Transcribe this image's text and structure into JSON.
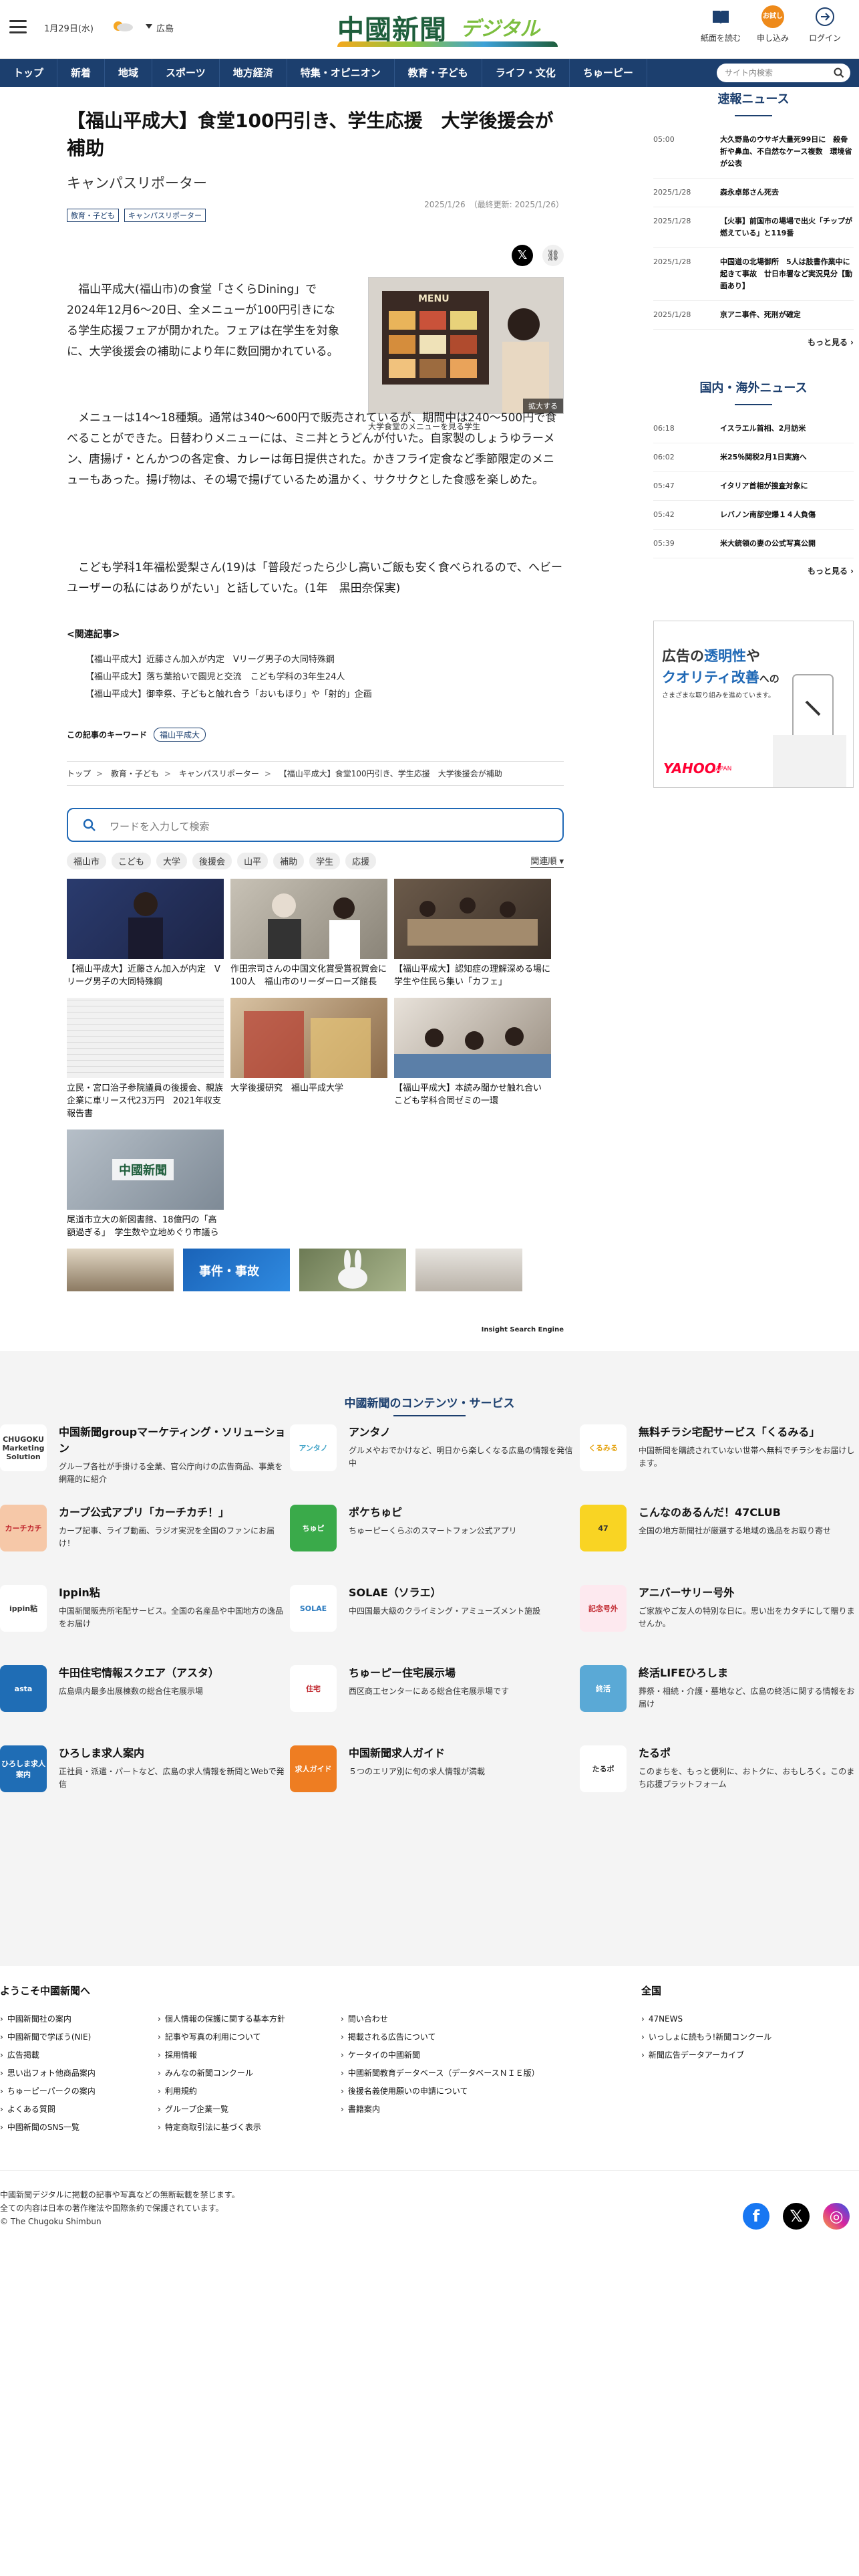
{
  "header": {
    "date": "1月29日(水)",
    "area": "広島",
    "logo_main": "中國新聞",
    "logo_sub": "デジタル",
    "btn_paper": "紙面を読む",
    "btn_apply": "申し込み",
    "btn_apply_badge": "お試し",
    "btn_login": "ログイン"
  },
  "nav": {
    "items": [
      "トップ",
      "新着",
      "地域",
      "スポーツ",
      "地方経済",
      "特集・オピニオン",
      "教育・子ども",
      "ライフ・文化",
      "ちゅーピー"
    ],
    "search_placeholder": "サイト内検索"
  },
  "article": {
    "title": "【福山平成大】食堂100円引き、学生応援　大学後援会が補助",
    "subtitle": "キャンパスリポーター",
    "tags": [
      "教育・子ども",
      "キャンパスリポーター"
    ],
    "date": "2025/1/26",
    "updated": "（最終更新: 2025/1/26）",
    "fig_caption": "大学食堂のメニューを見る学生",
    "fig_expand": "拡大する",
    "fig_menu": "MENU",
    "p1": "　福山平成大(福山市)の食堂「さくらDining」で2024年12月6～20日、全メニューが100円引きになる学生応援フェアが開かれた。フェアは在学生を対象に、大学後援会の補助により年に数回開かれている。",
    "p2": "　メニューは14～18種類。通常は340～600円で販売されているが、期間中は240～500円で食べることができた。日替わりメニューには、ミニ丼とうどんが付いた。自家製のしょうゆラーメン、唐揚げ・とんかつの各定食、カレーは毎日提供された。かきフライ定食など季節限定のメニューもあった。揚げ物は、その場で揚げているため温かく、サクサクとした食感を楽しめた。",
    "p3": "　こども学科1年福松愛梨さん(19)は「普段だったら少し高いご飯も安く食べられるので、へビーユーザーの私にはありがたい」と話していた。(1年　黒田奈保実)",
    "related_head": "<関連記事>",
    "related": [
      "【福山平成大】近藤さん加入が内定　Vリーグ男子の大同特殊鋼",
      "【福山平成大】落ち葉拾いで園児と交流　こども学科の3年生24人",
      "【福山平成大】御幸祭、子どもと触れ合う「おいもほり」や「射的」企画"
    ],
    "keyword_label": "この記事のキーワード",
    "keyword": "福山平成大",
    "breadcrumb": [
      "トップ",
      "教育・子ども",
      "キャンパスリポーター",
      "【福山平成大】食堂100円引き、学生応援　大学後援会が補助"
    ]
  },
  "ise": {
    "placeholder": "ワードを入力して検索",
    "keywords": [
      "福山市",
      "こども",
      "大学",
      "後援会",
      "山平",
      "補助",
      "学生",
      "応援"
    ],
    "sort": "関連順",
    "cards": [
      "【福山平成大】近藤さん加入が内定　Vリーグ男子の大同特殊鋼",
      "作田宗司さんの中国文化賞受賞祝賀会に100人　福山市のリーダーローズ館長",
      "【福山平成大】認知症の理解深める場に　学生や住民ら集い「カフェ」",
      "立民・宮口治子参院議員の後援会、親族企業に車リース代23万円　2021年収支報告書",
      "大学後援研究　福山平成大学",
      "【福山平成大】本読み聞かせ触れ合い　こども学科合同ゼミの一環",
      "尾道市立大の新図書館、18億円の「高額過ぎる」　学生数や立地めぐり市議ら"
    ],
    "card7_logo": "中國新聞",
    "strip_label": "事件・事故",
    "engine": "Insight Search Engine"
  },
  "side": {
    "head1": "速報ニュース",
    "news1": [
      {
        "t": "05:00",
        "x": "大久野島のウサギ大量死99日に　殺骨折や鼻血、不自然なケース複数　環境省が公表"
      },
      {
        "t": "2025/1/28",
        "x": "森永卓郎さん死去"
      },
      {
        "t": "2025/1/28",
        "x": "【火事】前国市の場場で出火「チップが燃えている」と119番"
      },
      {
        "t": "2025/1/28",
        "x": "中国道の北場御所　5人は肢書作業中に起きて事故　廿日市署など実況見分【動画あり】"
      },
      {
        "t": "2025/1/28",
        "x": "京アニ事件、死刑が確定"
      }
    ],
    "more": "もっと見る",
    "head2": "国内・海外ニュース",
    "news2": [
      {
        "t": "06:18",
        "x": "イスラエル首相、2月訪米"
      },
      {
        "t": "06:02",
        "x": "米25％関税2月1日実施へ"
      },
      {
        "t": "05:47",
        "x": "イタリア首相が捜査対象に"
      },
      {
        "t": "05:42",
        "x": "レバノン南部空爆１４人負傷"
      },
      {
        "t": "05:39",
        "x": "米大統領の妻の公式写真公開"
      }
    ],
    "ad_l1": "広告の",
    "ad_l1b": "透明性",
    "ad_l1c": "や",
    "ad_l2": "クオリティ改善",
    "ad_l2b": "への",
    "ad_l3": "さまざまな取り組みを進めています。",
    "ad_logo": "YAHOO!",
    "ad_logo_sub": "JAPAN"
  },
  "services": {
    "head": "中國新聞のコンテンツ・サービス",
    "items": [
      {
        "name": "中国新聞groupマーケティング・ソリューション",
        "desc": "グループ各社が手掛ける全業、官公庁向けの広告商品、事業を網羅的に紹介",
        "icon": "CHUGOKU Marketing Solution",
        "bg": "#fff",
        "fg": "#333"
      },
      {
        "name": "アンタノ",
        "desc": "グルメやおでかけなど、明日から楽しくなる広島の情報を発信中",
        "icon": "アンタノ",
        "bg": "#fff",
        "fg": "#46a6c9"
      },
      {
        "name": "無料チラシ宅配サービス「くるみる」",
        "desc": "中国新聞を購読されていない世帯へ無料でチラシをお届けします。",
        "icon": "くるみる",
        "bg": "#fff",
        "fg": "#e6a617"
      },
      {
        "name": "カープ公式アプリ「カーチカチ！」",
        "desc": "カープ記事、ライブ動画、ラジオ実況を全国のファンにお届け！",
        "icon": "カーチカチ",
        "bg": "#f6c8a8",
        "fg": "#c0262d"
      },
      {
        "name": "ポケちゅピ",
        "desc": "ちゅーピーくらぶのスマートフォン公式アプリ",
        "icon": "ちゅピ",
        "bg": "#3aaa4a",
        "fg": "#fff"
      },
      {
        "name": "こんなのあるんだ！47CLUB",
        "desc": "全国の地方新聞社が厳選する地域の逸品をお取り寄せ",
        "icon": "47",
        "bg": "#f9d423",
        "fg": "#333"
      },
      {
        "name": "Ippin粘",
        "desc": "中国新聞販売所宅配サービス。全国の名産品や中国地方の逸品をお届け",
        "icon": "ippin粘",
        "bg": "#fff",
        "fg": "#333"
      },
      {
        "name": "SOLAE（ソラエ）",
        "desc": "中四国最大級のクライミング・アミューズメント施設",
        "icon": "SOLAE",
        "bg": "#fff",
        "fg": "#2a7abf"
      },
      {
        "name": "アニバーサリー号外",
        "desc": "ご家族やご友人の特別な日に。思い出をカタチにして贈りませんか。",
        "icon": "記念号外",
        "bg": "#fde9ef",
        "fg": "#c0262d"
      },
      {
        "name": "牛田住宅情報スクエア（アスタ）",
        "desc": "広島県内最多出展棟数の総合住宅展示場",
        "icon": "asta",
        "bg": "#1f6db5",
        "fg": "#fff"
      },
      {
        "name": "ちゅーピー住宅展示場",
        "desc": "西区商工センターにある総合住宅展示場です",
        "icon": "住宅",
        "bg": "#fff",
        "fg": "#c0262d"
      },
      {
        "name": "終活LIFEひろしま",
        "desc": "葬祭・相続・介護・墓地など、広島の終活に関する情報をお届け",
        "icon": "終活",
        "bg": "#5aa9d6",
        "fg": "#fff"
      },
      {
        "name": "ひろしま求人案内",
        "desc": "正社員・派遣・パートなど、広島の求人情報を新聞とWebで発信",
        "icon": "ひろしま求人案内",
        "bg": "#1f6db5",
        "fg": "#fff"
      },
      {
        "name": "中国新聞求人ガイド",
        "desc": "５つのエリア別に旬の求人情報が満載",
        "icon": "求人ガイド",
        "bg": "#ee7d22",
        "fg": "#fff"
      },
      {
        "name": "たるポ",
        "desc": "このまちを、もっと便利に、おトクに、おもしろく。このまち応援プラットフォーム",
        "icon": "たるポ",
        "bg": "#fff",
        "fg": "#333"
      }
    ]
  },
  "links": {
    "head1": "ようこそ中國新聞へ",
    "col1": [
      "中國新聞社の案内",
      "中國新聞で学ぼう(NIE)",
      "広告掲載",
      "思い出フォト他商品案内",
      "ちゅーピーパークの案内",
      "よくある質問",
      "中國新聞のSNS一覧"
    ],
    "col2": [
      "個人情報の保護に関する基本方針",
      "記事や写真の利用について",
      "採用情報",
      "みんなの新聞コンクール",
      "利用規約",
      "グループ企業一覧",
      "特定商取引法に基づく表示"
    ],
    "col3": [
      "問い合わせ",
      "掲載される広告について",
      "ケータイの中國新聞",
      "中國新聞教育データベース（データベースＮＩＥ版）",
      "後援名義使用願いの申請について",
      "書籍案内"
    ],
    "head2": "全国",
    "col4": [
      "47NEWS",
      "いっしょに読もう!新聞コンクール",
      "新聞広告データアーカイブ"
    ]
  },
  "footer": {
    "l1": "中國新聞デジタルに掲載の記事や写真などの無断転載を禁じます。",
    "l2": "全ての内容は日本の著作権法や国際条約で保護されています。",
    "l3": "© The Chugoku Shimbun"
  }
}
